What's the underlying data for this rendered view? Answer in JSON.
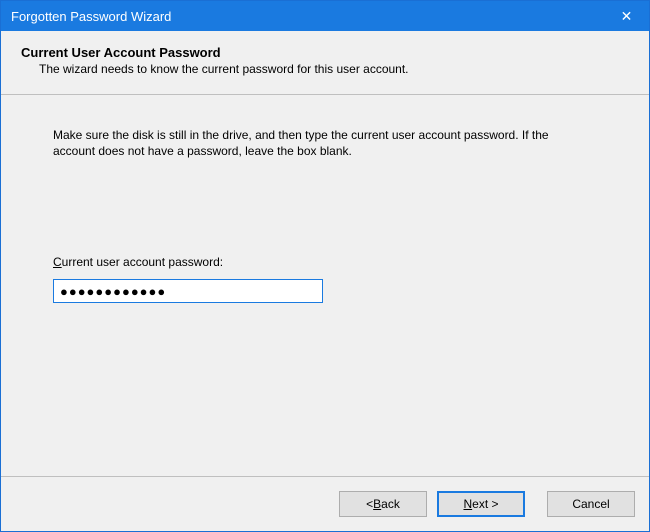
{
  "titlebar": {
    "title": "Forgotten Password Wizard",
    "close_symbol": "✕"
  },
  "header": {
    "title": "Current User Account Password",
    "subtitle": "The wizard needs to know the current password for this user account."
  },
  "content": {
    "instructions": "Make sure the disk is still in the drive, and then type the current user account password. If the account does not have a password, leave the box blank.",
    "field_label_underline": "C",
    "field_label_rest": "urrent user account password:",
    "password_value": "●●●●●●●●●●●●"
  },
  "buttons": {
    "back_prefix": "< ",
    "back_underline": "B",
    "back_rest": "ack",
    "next_underline": "N",
    "next_rest": "ext >",
    "cancel": "Cancel"
  }
}
